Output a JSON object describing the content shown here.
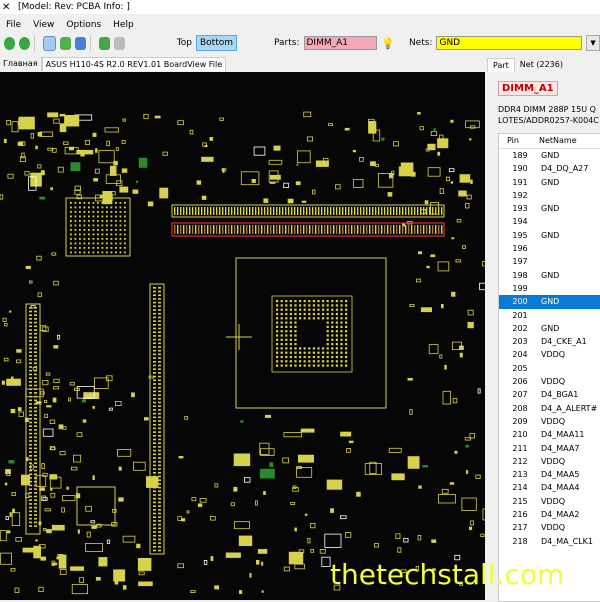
{
  "window": {
    "title": "[Model: Rev:  PCBA Info: ]"
  },
  "menu": [
    "File",
    "View",
    "Options",
    "Help"
  ],
  "toolbar": {
    "side_top": "Top",
    "side_bottom": "Bottom",
    "parts_label": "Parts:",
    "parts_value": "DIMM_A1",
    "nets_label": "Nets:",
    "nets_value": "GND"
  },
  "doc_tabs": [
    "Главная",
    "ASUS H110-4S R2.0 REV1.01 BoardView File"
  ],
  "panel": {
    "tabs": [
      "Part",
      "Net (2236)"
    ],
    "part_name": "DIMM_A1",
    "desc_line1": "DDR4 DIMM 288P 15U Q",
    "desc_line2": "LOTES/ADDR0257-K004C",
    "columns": {
      "pin": "Pin",
      "net": "NetName"
    },
    "rows": [
      {
        "pin": "189",
        "net": "GND"
      },
      {
        "pin": "190",
        "net": "D4_DQ_A27"
      },
      {
        "pin": "191",
        "net": "GND"
      },
      {
        "pin": "192",
        "net": ""
      },
      {
        "pin": "193",
        "net": "GND"
      },
      {
        "pin": "194",
        "net": ""
      },
      {
        "pin": "195",
        "net": "GND"
      },
      {
        "pin": "196",
        "net": ""
      },
      {
        "pin": "197",
        "net": ""
      },
      {
        "pin": "198",
        "net": "GND"
      },
      {
        "pin": "199",
        "net": ""
      },
      {
        "pin": "200",
        "net": "GND"
      },
      {
        "pin": "201",
        "net": ""
      },
      {
        "pin": "202",
        "net": "GND"
      },
      {
        "pin": "203",
        "net": "D4_CKE_A1"
      },
      {
        "pin": "204",
        "net": "VDDQ"
      },
      {
        "pin": "205",
        "net": ""
      },
      {
        "pin": "206",
        "net": "VDDQ"
      },
      {
        "pin": "207",
        "net": "D4_BGA1"
      },
      {
        "pin": "208",
        "net": "D4_A_ALERT#"
      },
      {
        "pin": "209",
        "net": "VDDQ"
      },
      {
        "pin": "210",
        "net": "D4_MAA11"
      },
      {
        "pin": "211",
        "net": "D4_MAA7"
      },
      {
        "pin": "212",
        "net": "VDDQ"
      },
      {
        "pin": "213",
        "net": "D4_MAA5"
      },
      {
        "pin": "214",
        "net": "D4_MAA4"
      },
      {
        "pin": "215",
        "net": "VDDQ"
      },
      {
        "pin": "216",
        "net": "D4_MAA2"
      },
      {
        "pin": "217",
        "net": "VDDQ"
      },
      {
        "pin": "218",
        "net": "D4_MA_CLK1"
      }
    ],
    "selected_pin": "200"
  },
  "watermark": "thetechstall.com",
  "colors": {
    "board_bg": "#060606",
    "trace": "#d7d24a",
    "highlight": "#e03030",
    "selection": "#0a78d7"
  }
}
